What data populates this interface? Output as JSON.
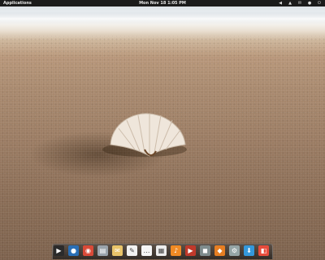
{
  "topbar": {
    "applications_label": "Applications",
    "clock": "Mon Nov 18  1:05 PM",
    "tray_icons": [
      "volume-icon",
      "network-icon",
      "mail-icon",
      "user-icon",
      "power-icon"
    ]
  },
  "dock": {
    "apps": [
      {
        "name": "terminal",
        "color": "#2b2b2b",
        "glyph": "▶"
      },
      {
        "name": "web-browser",
        "color": "#2a6fb6",
        "glyph": "●"
      },
      {
        "name": "chrome",
        "color": "#d94a38",
        "glyph": "◉"
      },
      {
        "name": "files",
        "color": "#9aa3ab",
        "glyph": "▤"
      },
      {
        "name": "mail",
        "color": "#e9c46a",
        "glyph": "✉"
      },
      {
        "name": "text-editor",
        "color": "#f1f1f1",
        "glyph": "✎"
      },
      {
        "name": "messaging",
        "color": "#f5f5f5",
        "glyph": "…"
      },
      {
        "name": "calendar",
        "color": "#ececec",
        "glyph": "▦"
      },
      {
        "name": "music",
        "color": "#f08a24",
        "glyph": "♪"
      },
      {
        "name": "media-player",
        "color": "#c0392b",
        "glyph": "▶"
      },
      {
        "name": "photos",
        "color": "#7f8c8d",
        "glyph": "◼"
      },
      {
        "name": "software-center",
        "color": "#e67e22",
        "glyph": "◆"
      },
      {
        "name": "settings",
        "color": "#95a5a6",
        "glyph": "⚙"
      },
      {
        "name": "downloads",
        "color": "#3498db",
        "glyph": "⬇"
      },
      {
        "name": "appearance",
        "color": "#e74c3c",
        "glyph": "◧"
      }
    ]
  }
}
